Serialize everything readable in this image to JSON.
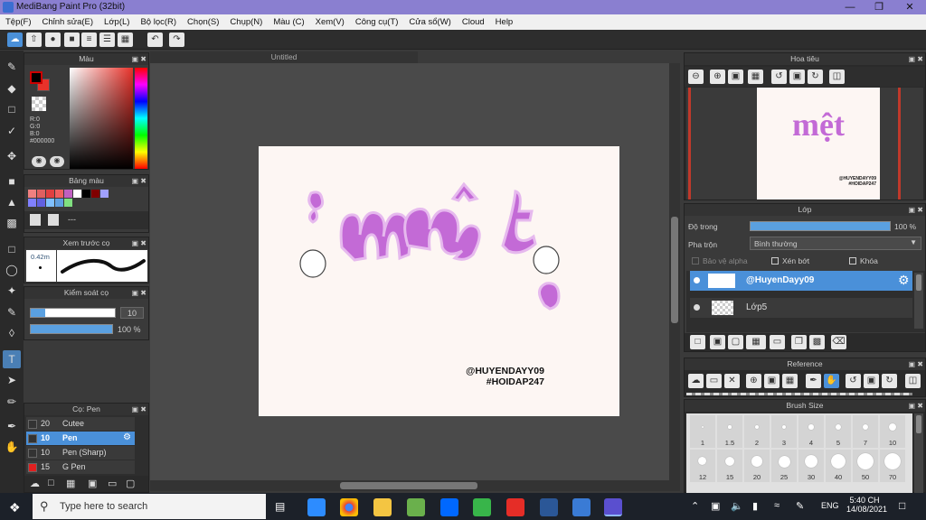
{
  "window": {
    "title": "MediBang Paint Pro (32bit)"
  },
  "menu": [
    "Tệp(F)",
    "Chỉnh sửa(E)",
    "Lớp(L)",
    "Bộ lọc(R)",
    "Chọn(S)",
    "Chụp(N)",
    "Màu (C)",
    "Xem(V)",
    "Công cụ(T)",
    "Cửa sổ(W)",
    "Cloud",
    "Help"
  ],
  "canvas": {
    "tab": "Untitled",
    "watermark_line1": "@HUYENDAYY09",
    "watermark_line2": "#HOIDAP247",
    "art_text": "mệt"
  },
  "color_panel": {
    "title": "Màu",
    "r": "R:0",
    "g": "G:0",
    "b": "B:0",
    "hex": "#000000",
    "fg": "#000000",
    "bg": "#e8322a"
  },
  "palette_panel": {
    "title": "Bảng màu",
    "name": "---",
    "swatches": [
      "#f08080",
      "#e06060",
      "#e04040",
      "#f06060",
      "#c060c0",
      "#ffffff",
      "#000000",
      "#800000",
      "#a0a0ff",
      "#8080ff",
      "#6060e0",
      "#80c0ff",
      "#60a0e0",
      "#80e080"
    ]
  },
  "preview_panel": {
    "title": "Xem trước cọ",
    "size": "0.42m"
  },
  "control_panel": {
    "title": "Kiểm soát cọ",
    "size": "10",
    "opacity": "100 %"
  },
  "brush_panel": {
    "title": "Cọ: Pen",
    "items": [
      {
        "size": "20",
        "name": "Cutee",
        "color": "#333333"
      },
      {
        "size": "10",
        "name": "Pen",
        "color": "#333333"
      },
      {
        "size": "10",
        "name": "Pen (Sharp)",
        "color": "#333333"
      },
      {
        "size": "15",
        "name": "G Pen",
        "color": "#e02020"
      }
    ]
  },
  "navigator": {
    "title": "Hoa tiêu"
  },
  "layer_panel": {
    "title": "Lớp",
    "opacity_label": "Độ trong",
    "opacity_value": "100 %",
    "blend_label": "Pha trộn",
    "blend_value": "Bình thường",
    "protect_alpha": "Bảo vệ alpha",
    "clip": "Xén bớt",
    "lock": "Khóa",
    "layers": [
      {
        "name": "@HuyenDayy09",
        "selected": true
      },
      {
        "name": "Lớp5",
        "selected": false
      }
    ]
  },
  "reference": {
    "title": "Reference"
  },
  "brush_size": {
    "title": "Brush Size",
    "row1": [
      "1",
      "1.5",
      "2",
      "3",
      "4",
      "5",
      "7",
      "10"
    ],
    "row2": [
      "12",
      "15",
      "20",
      "25",
      "30",
      "40",
      "50",
      "70"
    ]
  },
  "taskbar": {
    "search_placeholder": "Type here to search",
    "lang": "ENG",
    "time": "5:40 CH",
    "date": "14/08/2021"
  }
}
